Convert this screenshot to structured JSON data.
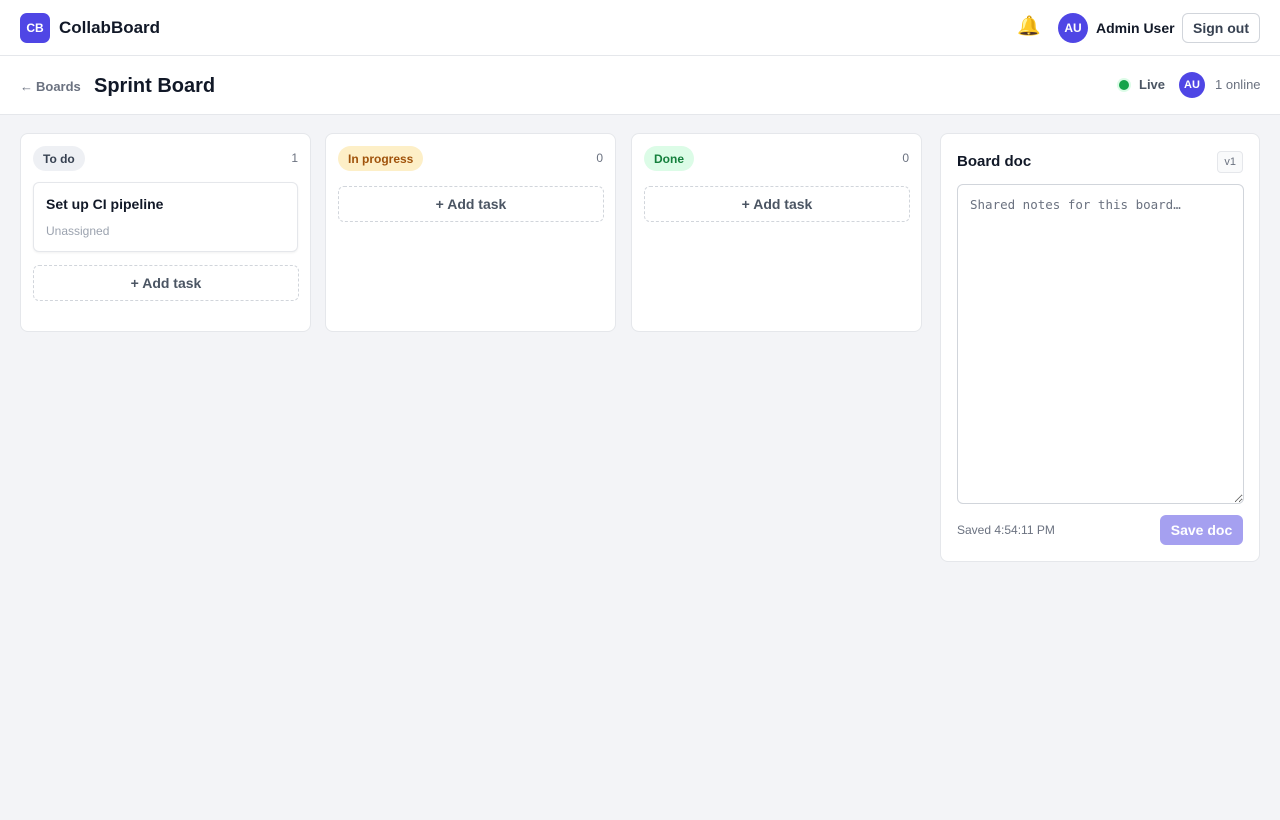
{
  "app": {
    "logo": "CB",
    "name": "CollabBoard"
  },
  "header": {
    "bell_icon": "bell-icon",
    "user_initials": "AU",
    "user_name": "Admin User",
    "sign_out_label": "Sign out"
  },
  "board": {
    "back_label": "Boards",
    "back_icon": "arrow-left-icon",
    "title": "Sprint Board",
    "live_label": "Live",
    "presence_initials": "AU",
    "online_label": "1 online"
  },
  "columns": [
    {
      "label": "To do",
      "count": "1",
      "tasks": [
        {
          "title": "Set up CI pipeline",
          "assignee": "Unassigned"
        }
      ],
      "add_label": "+ Add task"
    },
    {
      "label": "In progress",
      "count": "0",
      "tasks": [],
      "add_label": "+ Add task"
    },
    {
      "label": "Done",
      "count": "0",
      "tasks": [],
      "add_label": "+ Add task"
    }
  ],
  "doc": {
    "title": "Board doc",
    "version": "v1",
    "value": "",
    "placeholder": "Shared notes for this board…",
    "saved_status": "Saved 4:54:11 PM",
    "save_label": "Save doc"
  },
  "colors": {
    "accent": "#4f46e5",
    "live": "#16a34a",
    "todo_pill": "#eef0f4",
    "in_progress_pill": "#fdefc7",
    "done_pill": "#dcfce7",
    "save_disabled": "#a5a0f0"
  }
}
